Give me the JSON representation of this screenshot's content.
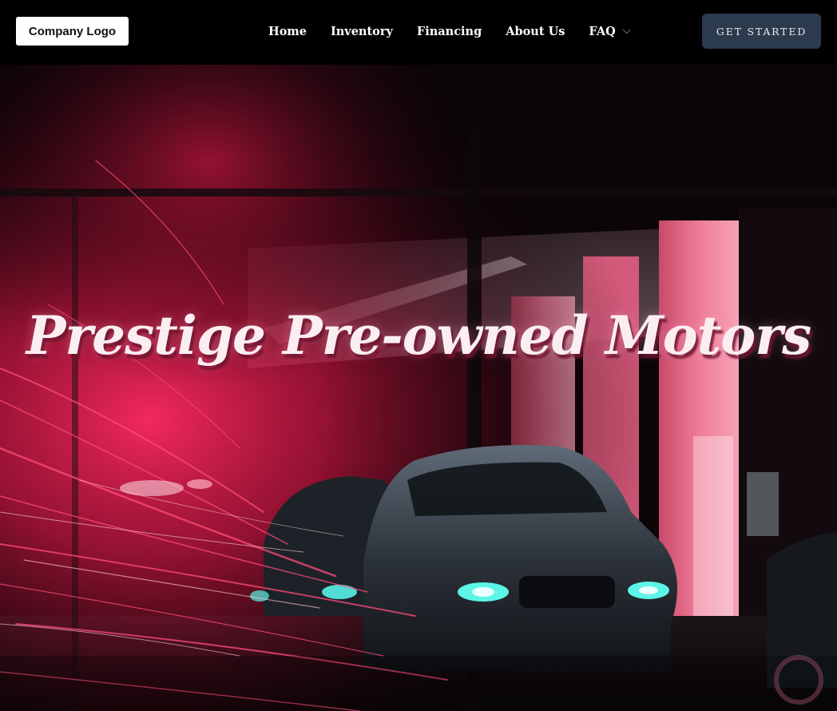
{
  "header": {
    "logo_label": "Company Logo",
    "nav": [
      {
        "label": "Home"
      },
      {
        "label": "Inventory"
      },
      {
        "label": "Financing"
      },
      {
        "label": "About Us"
      },
      {
        "label": "FAQ",
        "has_dropdown": true
      }
    ],
    "cta_label": "GET STARTED",
    "cta_color": "#2c3a4d"
  },
  "hero": {
    "title": "Prestige Pre-owned Motors",
    "background_image": "car-showroom-neon-photo",
    "accent_color": "#e0245a"
  }
}
